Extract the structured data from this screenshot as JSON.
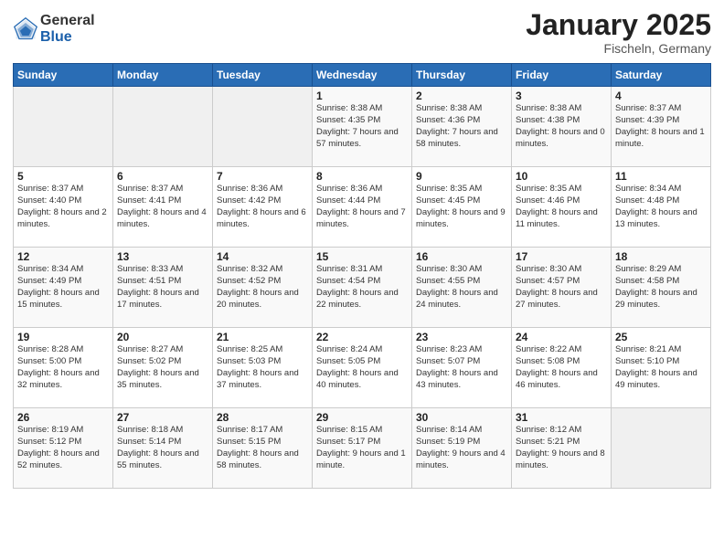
{
  "header": {
    "logo_general": "General",
    "logo_blue": "Blue",
    "month": "January 2025",
    "location": "Fischeln, Germany"
  },
  "days_of_week": [
    "Sunday",
    "Monday",
    "Tuesday",
    "Wednesday",
    "Thursday",
    "Friday",
    "Saturday"
  ],
  "weeks": [
    [
      {
        "day": "",
        "info": ""
      },
      {
        "day": "",
        "info": ""
      },
      {
        "day": "",
        "info": ""
      },
      {
        "day": "1",
        "info": "Sunrise: 8:38 AM\nSunset: 4:35 PM\nDaylight: 7 hours\nand 57 minutes."
      },
      {
        "day": "2",
        "info": "Sunrise: 8:38 AM\nSunset: 4:36 PM\nDaylight: 7 hours\nand 58 minutes."
      },
      {
        "day": "3",
        "info": "Sunrise: 8:38 AM\nSunset: 4:38 PM\nDaylight: 8 hours\nand 0 minutes."
      },
      {
        "day": "4",
        "info": "Sunrise: 8:37 AM\nSunset: 4:39 PM\nDaylight: 8 hours\nand 1 minute."
      }
    ],
    [
      {
        "day": "5",
        "info": "Sunrise: 8:37 AM\nSunset: 4:40 PM\nDaylight: 8 hours\nand 2 minutes."
      },
      {
        "day": "6",
        "info": "Sunrise: 8:37 AM\nSunset: 4:41 PM\nDaylight: 8 hours\nand 4 minutes."
      },
      {
        "day": "7",
        "info": "Sunrise: 8:36 AM\nSunset: 4:42 PM\nDaylight: 8 hours\nand 6 minutes."
      },
      {
        "day": "8",
        "info": "Sunrise: 8:36 AM\nSunset: 4:44 PM\nDaylight: 8 hours\nand 7 minutes."
      },
      {
        "day": "9",
        "info": "Sunrise: 8:35 AM\nSunset: 4:45 PM\nDaylight: 8 hours\nand 9 minutes."
      },
      {
        "day": "10",
        "info": "Sunrise: 8:35 AM\nSunset: 4:46 PM\nDaylight: 8 hours\nand 11 minutes."
      },
      {
        "day": "11",
        "info": "Sunrise: 8:34 AM\nSunset: 4:48 PM\nDaylight: 8 hours\nand 13 minutes."
      }
    ],
    [
      {
        "day": "12",
        "info": "Sunrise: 8:34 AM\nSunset: 4:49 PM\nDaylight: 8 hours\nand 15 minutes."
      },
      {
        "day": "13",
        "info": "Sunrise: 8:33 AM\nSunset: 4:51 PM\nDaylight: 8 hours\nand 17 minutes."
      },
      {
        "day": "14",
        "info": "Sunrise: 8:32 AM\nSunset: 4:52 PM\nDaylight: 8 hours\nand 20 minutes."
      },
      {
        "day": "15",
        "info": "Sunrise: 8:31 AM\nSunset: 4:54 PM\nDaylight: 8 hours\nand 22 minutes."
      },
      {
        "day": "16",
        "info": "Sunrise: 8:30 AM\nSunset: 4:55 PM\nDaylight: 8 hours\nand 24 minutes."
      },
      {
        "day": "17",
        "info": "Sunrise: 8:30 AM\nSunset: 4:57 PM\nDaylight: 8 hours\nand 27 minutes."
      },
      {
        "day": "18",
        "info": "Sunrise: 8:29 AM\nSunset: 4:58 PM\nDaylight: 8 hours\nand 29 minutes."
      }
    ],
    [
      {
        "day": "19",
        "info": "Sunrise: 8:28 AM\nSunset: 5:00 PM\nDaylight: 8 hours\nand 32 minutes."
      },
      {
        "day": "20",
        "info": "Sunrise: 8:27 AM\nSunset: 5:02 PM\nDaylight: 8 hours\nand 35 minutes."
      },
      {
        "day": "21",
        "info": "Sunrise: 8:25 AM\nSunset: 5:03 PM\nDaylight: 8 hours\nand 37 minutes."
      },
      {
        "day": "22",
        "info": "Sunrise: 8:24 AM\nSunset: 5:05 PM\nDaylight: 8 hours\nand 40 minutes."
      },
      {
        "day": "23",
        "info": "Sunrise: 8:23 AM\nSunset: 5:07 PM\nDaylight: 8 hours\nand 43 minutes."
      },
      {
        "day": "24",
        "info": "Sunrise: 8:22 AM\nSunset: 5:08 PM\nDaylight: 8 hours\nand 46 minutes."
      },
      {
        "day": "25",
        "info": "Sunrise: 8:21 AM\nSunset: 5:10 PM\nDaylight: 8 hours\nand 49 minutes."
      }
    ],
    [
      {
        "day": "26",
        "info": "Sunrise: 8:19 AM\nSunset: 5:12 PM\nDaylight: 8 hours\nand 52 minutes."
      },
      {
        "day": "27",
        "info": "Sunrise: 8:18 AM\nSunset: 5:14 PM\nDaylight: 8 hours\nand 55 minutes."
      },
      {
        "day": "28",
        "info": "Sunrise: 8:17 AM\nSunset: 5:15 PM\nDaylight: 8 hours\nand 58 minutes."
      },
      {
        "day": "29",
        "info": "Sunrise: 8:15 AM\nSunset: 5:17 PM\nDaylight: 9 hours\nand 1 minute."
      },
      {
        "day": "30",
        "info": "Sunrise: 8:14 AM\nSunset: 5:19 PM\nDaylight: 9 hours\nand 4 minutes."
      },
      {
        "day": "31",
        "info": "Sunrise: 8:12 AM\nSunset: 5:21 PM\nDaylight: 9 hours\nand 8 minutes."
      },
      {
        "day": "",
        "info": ""
      }
    ]
  ]
}
